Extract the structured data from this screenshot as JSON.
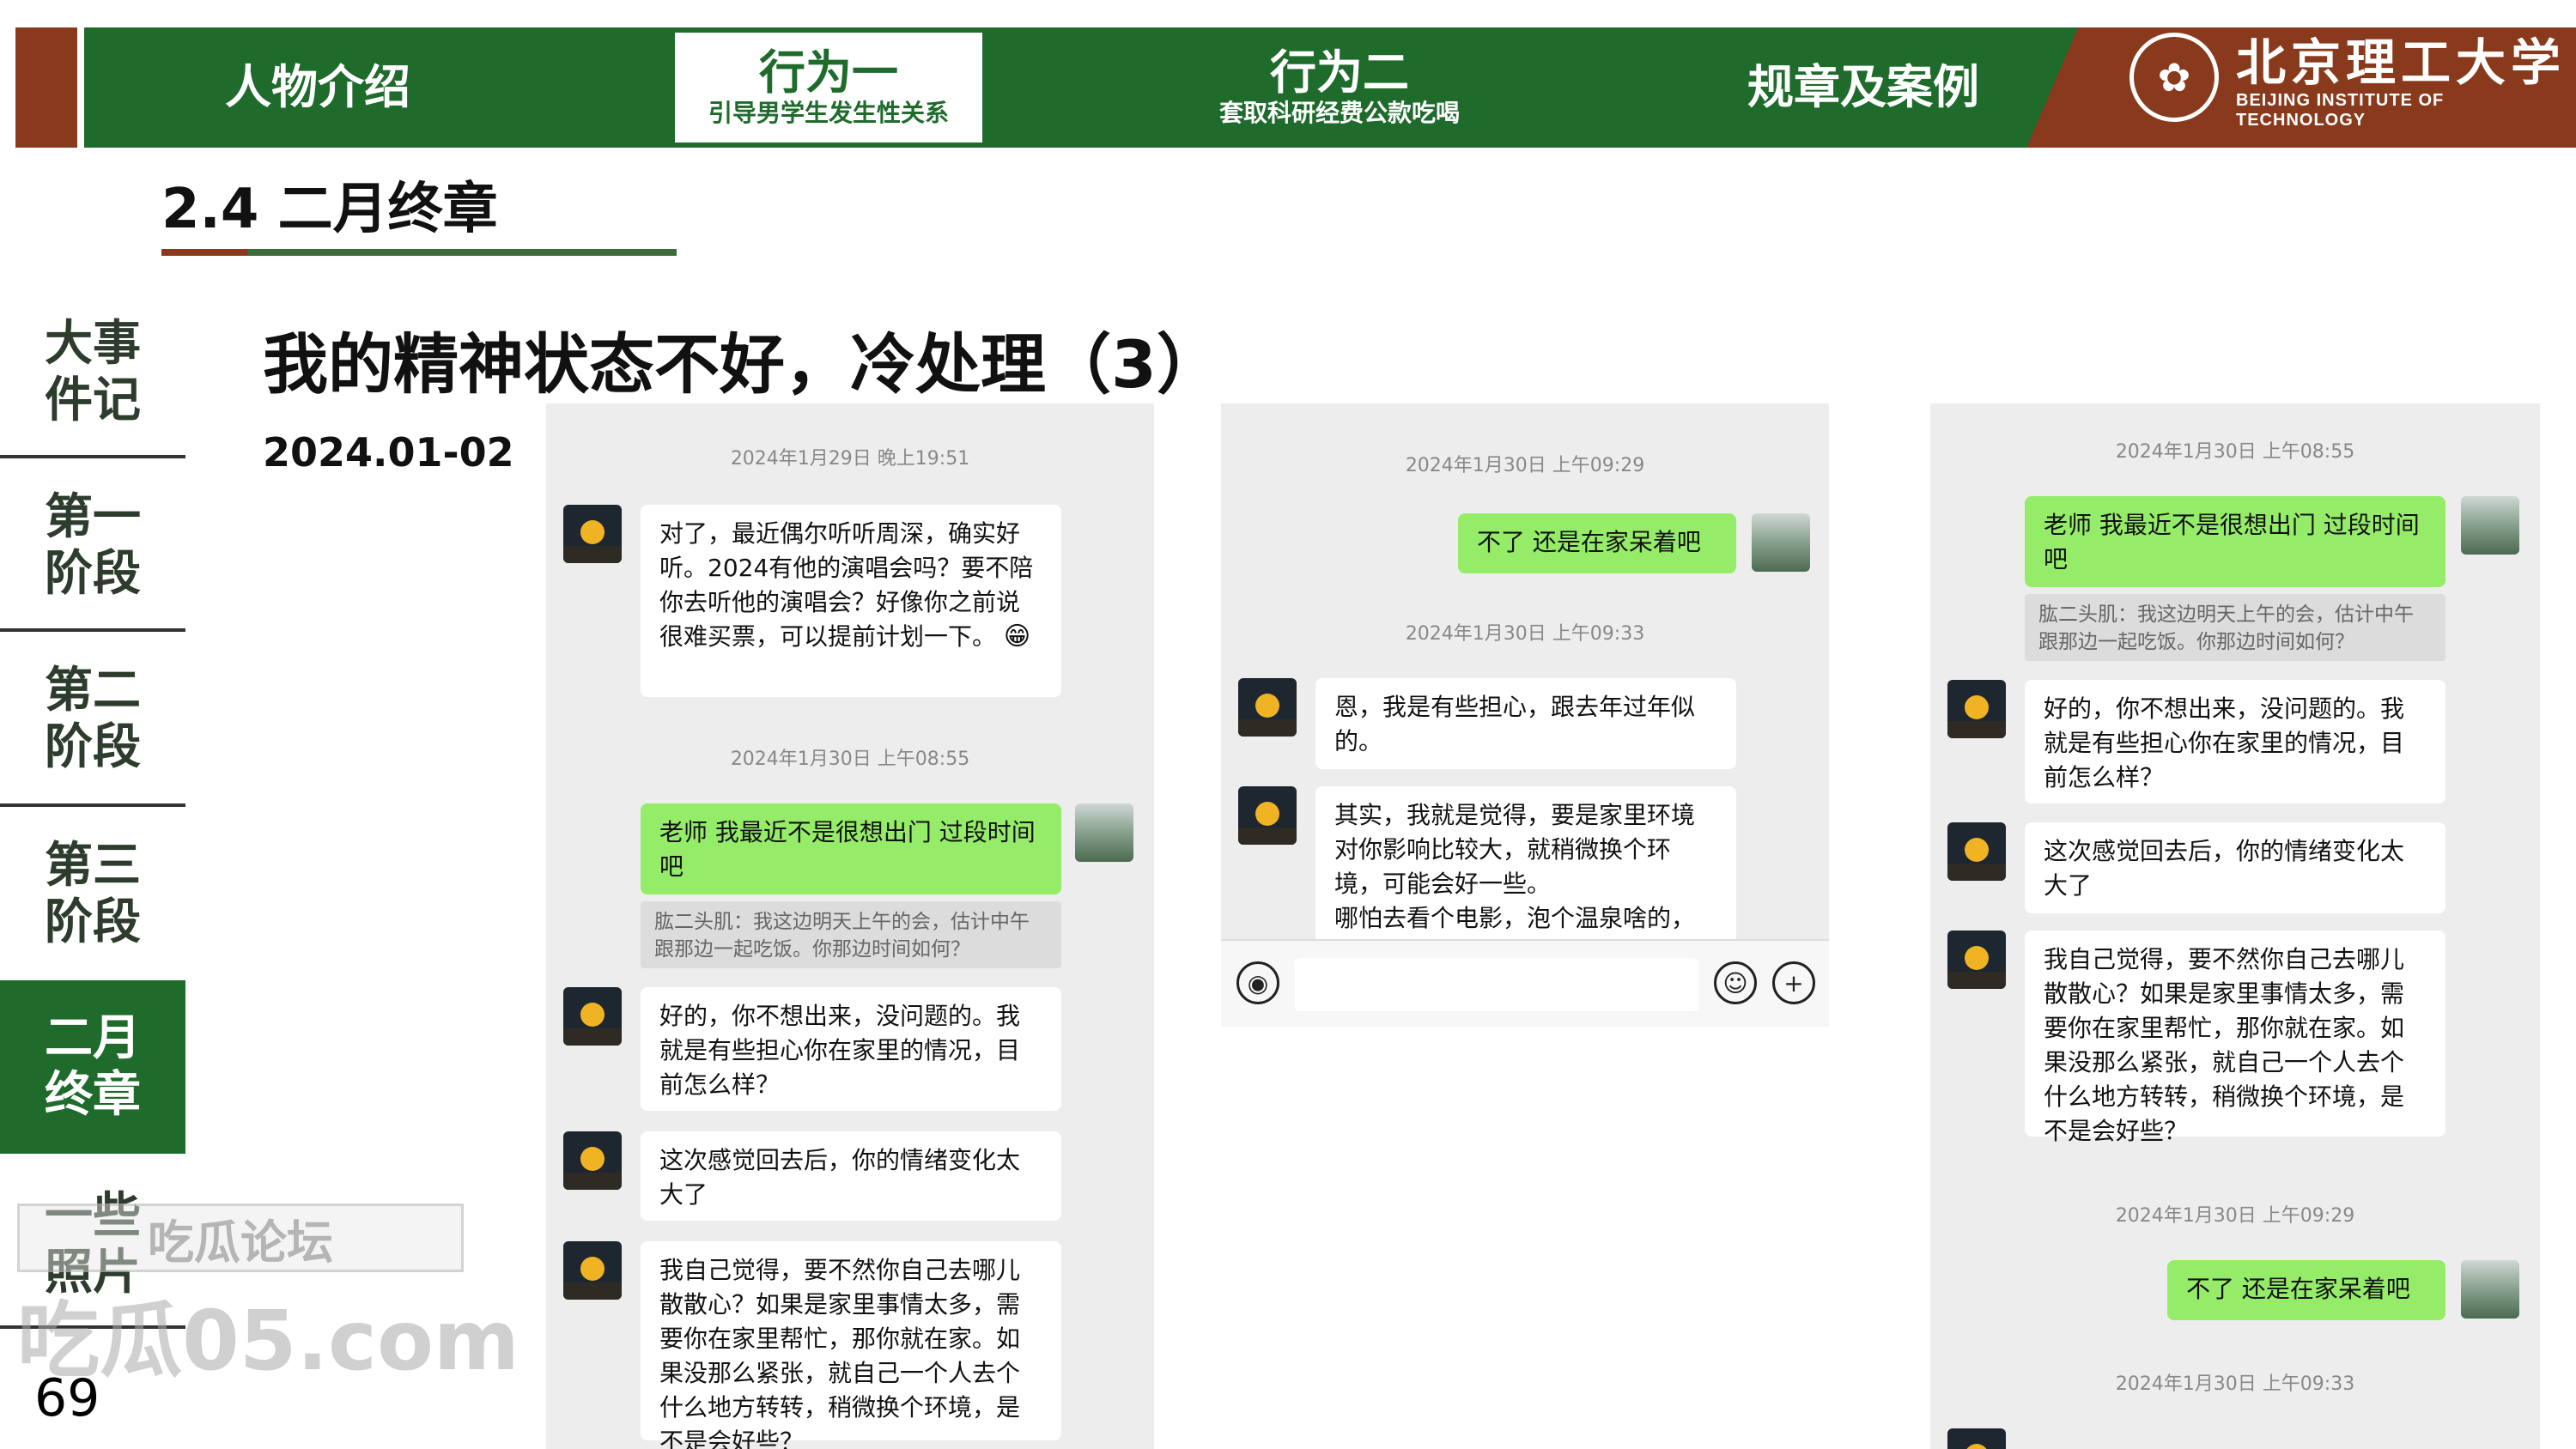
{
  "nav": {
    "items": [
      {
        "main": "人物介绍",
        "sub": ""
      },
      {
        "main": "行为一",
        "sub": "引导男学生发生性关系"
      },
      {
        "main": "行为二",
        "sub": "套取科研经费公款吃喝"
      },
      {
        "main": "规章及案例",
        "sub": ""
      }
    ],
    "logo_cn": "北京理工大学",
    "logo_en": "BEIJING INSTITUTE OF TECHNOLOGY",
    "colors": {
      "green": "#1e6b2c",
      "brown": "#8a3a1c"
    }
  },
  "section": {
    "title": "2.4 二月终章"
  },
  "sidebar": {
    "items": [
      {
        "label": "大事件记",
        "lines": [
          "大事",
          "件记"
        ]
      },
      {
        "label": "第一阶段",
        "lines": [
          "第一",
          "阶段"
        ]
      },
      {
        "label": "第二阶段",
        "lines": [
          "第二",
          "阶段"
        ]
      },
      {
        "label": "第三阶段",
        "lines": [
          "第三",
          "阶段"
        ]
      },
      {
        "label": "二月终章",
        "lines": [
          "二月",
          "终章"
        ]
      },
      {
        "label": "一些照片",
        "lines": [
          "一些",
          "照片"
        ]
      }
    ]
  },
  "page_number": "69",
  "watermark": {
    "line1": "吃瓜论坛",
    "line2": "吃瓜05.com"
  },
  "slide": {
    "title": "我的精神状态不好，冷处理（3）",
    "date": "2024.01-02"
  },
  "chats": {
    "p1": {
      "ts1": "2024年1月29日 晚上19:51",
      "m1": "对了，最近偶尔听听周深，确实好听。2024有他的演唱会吗？要不陪你去听他的演唱会？好像你之前说很难买票，可以提前计划一下。",
      "m1_emoji": "😁",
      "ts2": "2024年1月30日 上午08:55",
      "m2": "老师 我最近不是很想出门 过段时间吧",
      "q2": "肱二头肌：我这边明天上午的会，估计中午跟那边一起吃饭。你那边时间如何？",
      "m3": "好的，你不想出来，没问题的。我就是有些担心你在家里的情况，目前怎么样？",
      "m4": "这次感觉回去后，你的情绪变化太大了",
      "m5": "我自己觉得，要不然你自己去哪儿散散心？如果是家里事情太多，需要你在家里帮忙，那你就在家。如果没那么紧张，就自己一个人去个什么地方转转，稍微换个环境，是不是会好些？"
    },
    "p2": {
      "ts1": "2024年1月30日 上午09:29",
      "m1": "不了 还是在家呆着吧",
      "ts2": "2024年1月30日 上午09:33",
      "m2": "恩，我是有些担心，跟去年过年似的。",
      "m3": "其实，我就是觉得，要是家里环境对你影响比较大，就稍微换个环境，可能会好一些。\n哪怕去看个电影，泡个温泉啥的，"
    },
    "p3": {
      "ts1": "2024年1月30日 上午08:55",
      "m1": "老师 我最近不是很想出门 过段时间吧",
      "q1": "肱二头肌：我这边明天上午的会，估计中午跟那边一起吃饭。你那边时间如何？",
      "m2": "好的，你不想出来，没问题的。我就是有些担心你在家里的情况，目前怎么样？",
      "m3": "这次感觉回去后，你的情绪变化太大了",
      "m4": "我自己觉得，要不然你自己去哪儿散散心？如果是家里事情太多，需要你在家里帮忙，那你就在家。如果没那么紧张，就自己一个人去个什么地方转转，稍微换个环境，是不是会好些？",
      "ts2": "2024年1月30日 上午09:29",
      "m5": "不了 还是在家呆着吧",
      "ts3": "2024年1月30日 上午09:33"
    }
  },
  "icons": {
    "voice": "voice-icon",
    "emoji": "emoji-icon",
    "add": "add-icon"
  }
}
